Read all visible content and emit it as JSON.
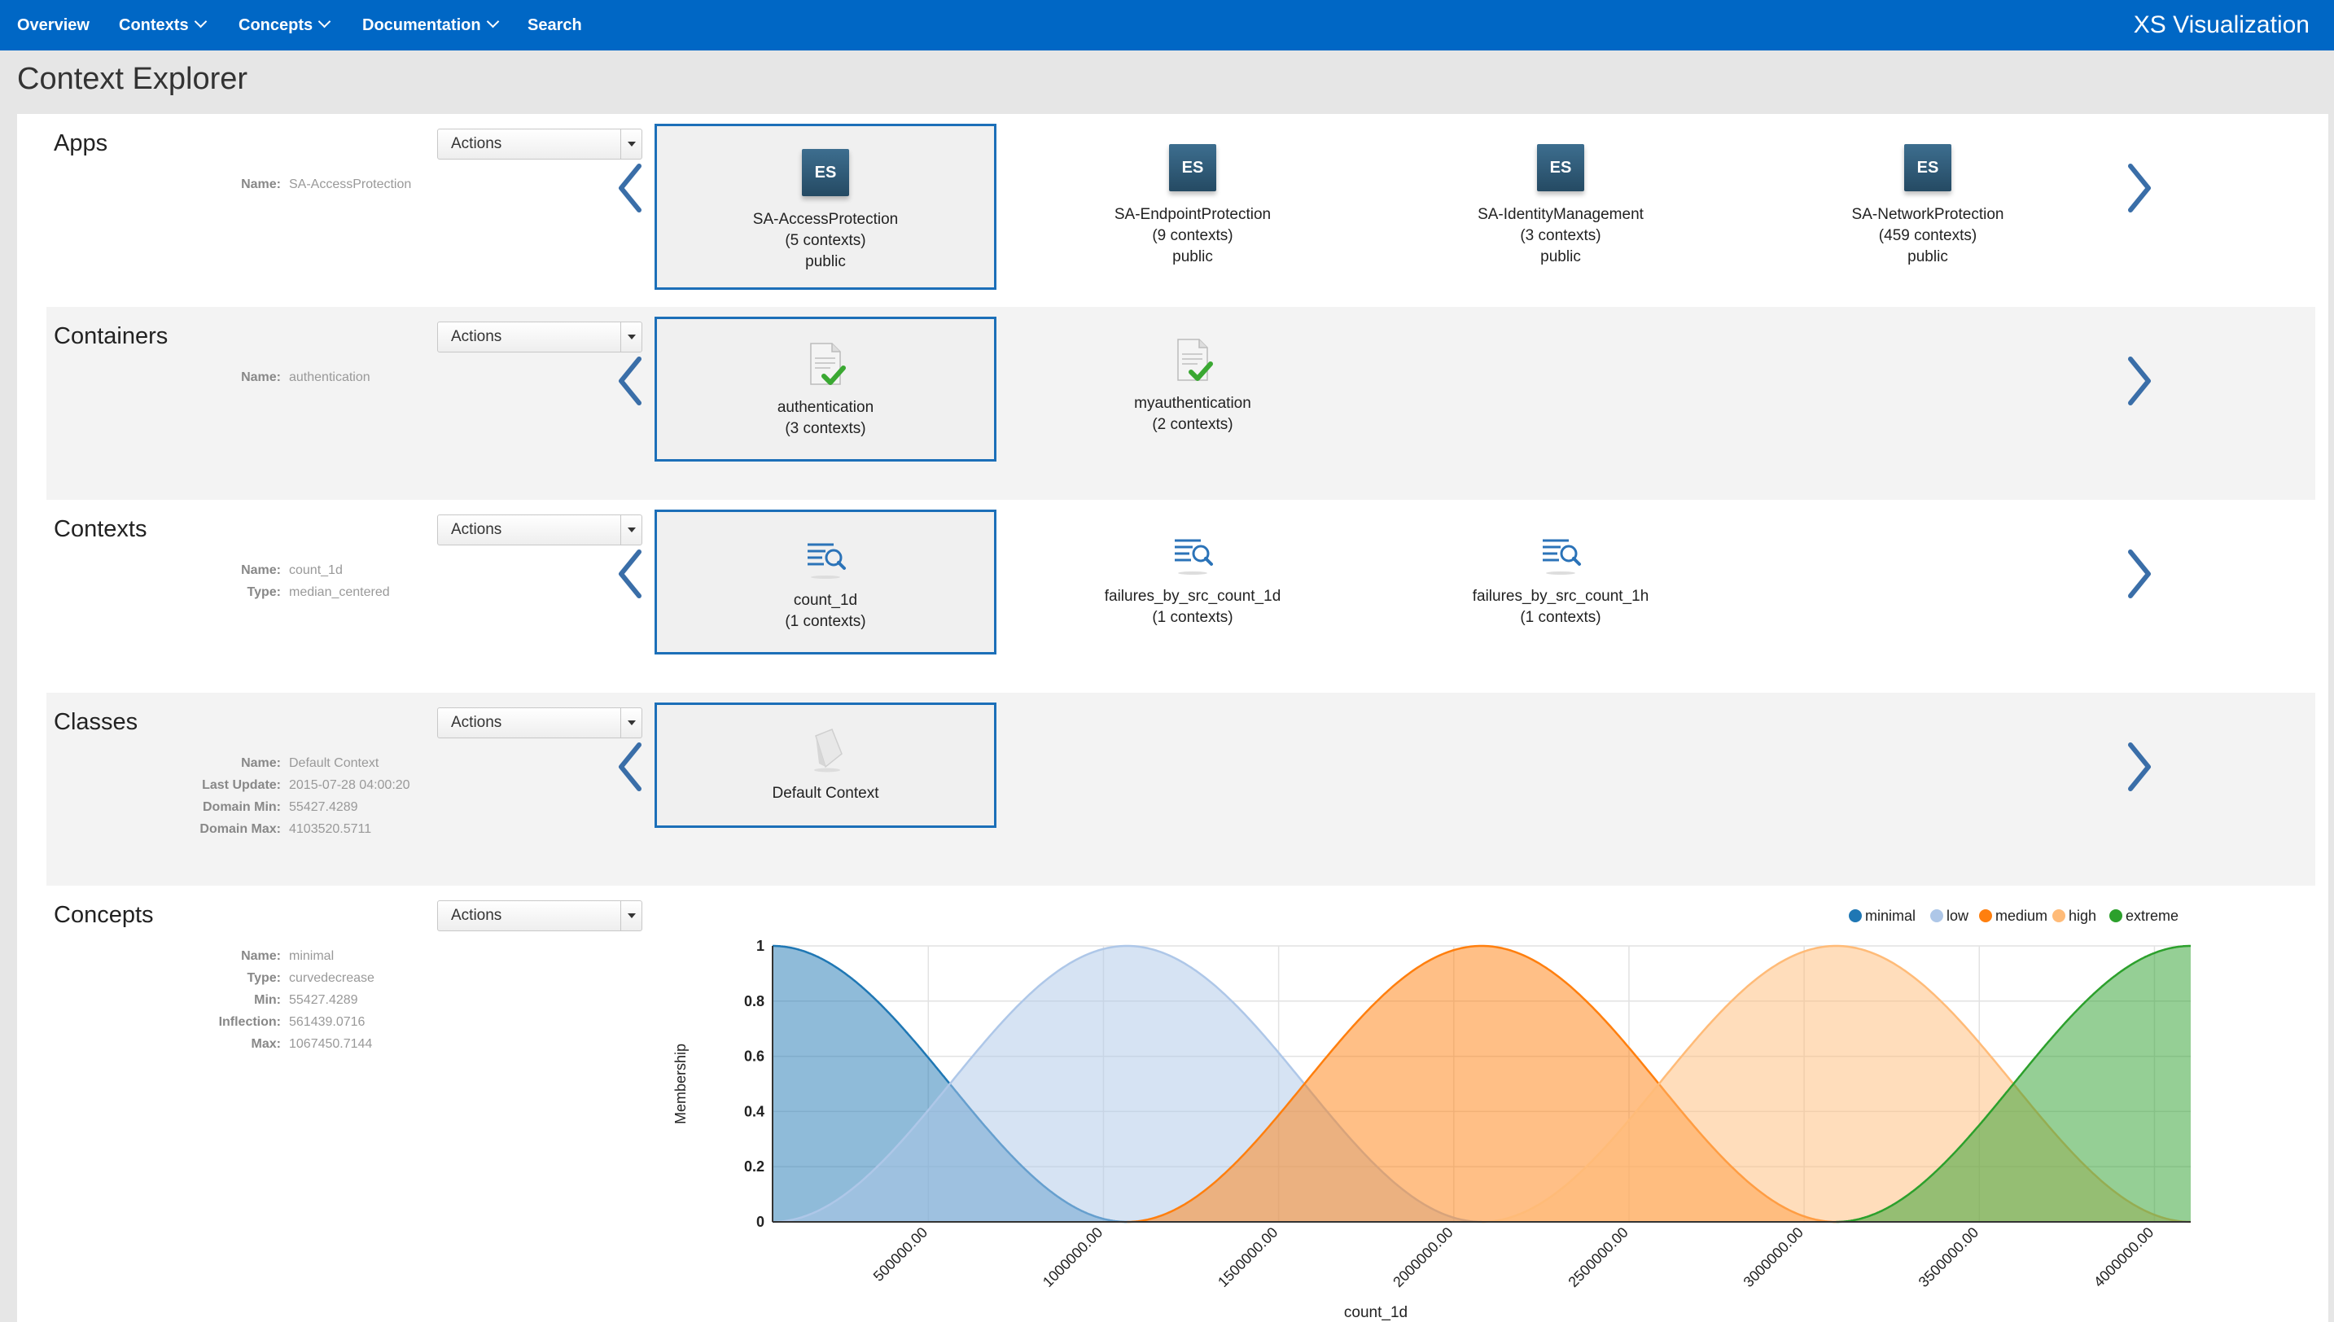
{
  "nav": {
    "items": [
      {
        "label": "Overview",
        "dropdown": false
      },
      {
        "label": "Contexts",
        "dropdown": true
      },
      {
        "label": "Concepts",
        "dropdown": true
      },
      {
        "label": "Documentation",
        "dropdown": true
      },
      {
        "label": "Search",
        "dropdown": false
      }
    ],
    "brand": "XS Visualization"
  },
  "page_title": "Context Explorer",
  "actions_label": "Actions",
  "sections": {
    "apps": {
      "title": "Apps",
      "meta": [
        {
          "key": "Name:",
          "value": "SA-AccessProtection"
        }
      ],
      "cards": [
        {
          "name": "SA-AccessProtection",
          "count": "(5 contexts)",
          "visibility": "public",
          "icon": "es-app-icon",
          "icon_text": "ES",
          "selected": true
        },
        {
          "name": "SA-EndpointProtection",
          "count": "(9 contexts)",
          "visibility": "public",
          "icon": "es-app-icon",
          "icon_text": "ES",
          "selected": false
        },
        {
          "name": "SA-IdentityManagement",
          "count": "(3 contexts)",
          "visibility": "public",
          "icon": "es-app-icon",
          "icon_text": "ES",
          "selected": false
        },
        {
          "name": "SA-NetworkProtection",
          "count": "(459 contexts)",
          "visibility": "public",
          "icon": "es-app-icon",
          "icon_text": "ES",
          "selected": false
        }
      ]
    },
    "containers": {
      "title": "Containers",
      "meta": [
        {
          "key": "Name:",
          "value": "authentication"
        }
      ],
      "cards": [
        {
          "name": "authentication",
          "count": "(3 contexts)",
          "icon": "document-check-icon",
          "selected": true
        },
        {
          "name": "myauthentication",
          "count": "(2 contexts)",
          "icon": "document-check-icon",
          "selected": false
        }
      ]
    },
    "contexts": {
      "title": "Contexts",
      "meta": [
        {
          "key": "Name:",
          "value": "count_1d"
        },
        {
          "key": "Type:",
          "value": "median_centered"
        }
      ],
      "cards": [
        {
          "name": "count_1d",
          "count": "(1 contexts)",
          "icon": "list-search-icon",
          "selected": true
        },
        {
          "name": "failures_by_src_count_1d",
          "count": "(1 contexts)",
          "icon": "list-search-icon",
          "selected": false
        },
        {
          "name": "failures_by_src_count_1h",
          "count": "(1 contexts)",
          "icon": "list-search-icon",
          "selected": false
        }
      ]
    },
    "classes": {
      "title": "Classes",
      "meta": [
        {
          "key": "Name:",
          "value": "Default Context"
        },
        {
          "key": "Last Update:",
          "value": "2015-07-28 04:00:20"
        },
        {
          "key": "Domain Min:",
          "value": "55427.4289"
        },
        {
          "key": "Domain Max:",
          "value": "4103520.5711"
        }
      ],
      "cards": [
        {
          "name": "Default Context",
          "icon": "paper-icon",
          "selected": true
        }
      ]
    },
    "concepts": {
      "title": "Concepts",
      "meta": [
        {
          "key": "Name:",
          "value": "minimal"
        },
        {
          "key": "Type:",
          "value": "curvedecrease"
        },
        {
          "key": "Min:",
          "value": "55427.4289"
        },
        {
          "key": "Inflection:",
          "value": "561439.0716"
        },
        {
          "key": "Max:",
          "value": "1067450.7144"
        }
      ]
    }
  },
  "chart_data": {
    "type": "area",
    "xlabel": "count_1d",
    "ylabel": "Membership",
    "xlim": [
      55427.4289,
      4103520.5711
    ],
    "ylim": [
      0,
      1
    ],
    "x_ticks": [
      "500000.00",
      "1000000.00",
      "1500000.00",
      "2000000.00",
      "2500000.00",
      "3000000.00",
      "3500000.00",
      "4000000.00"
    ],
    "x_tick_values": [
      500000,
      1000000,
      1500000,
      2000000,
      2500000,
      3000000,
      3500000,
      4000000
    ],
    "y_ticks": [
      "0",
      "0.2",
      "0.4",
      "0.6",
      "0.8",
      "1"
    ],
    "y_tick_values": [
      0,
      0.2,
      0.4,
      0.6,
      0.8,
      1
    ],
    "grid": true,
    "legend": "top-right",
    "series": [
      {
        "name": "minimal",
        "color": "#1f77b4",
        "x": [
          55427,
          561439,
          1067451
        ],
        "y": [
          1,
          0.5,
          0
        ]
      },
      {
        "name": "low",
        "color": "#aec7e8",
        "x": [
          55427,
          1067451,
          2079474
        ],
        "y": [
          0,
          1,
          0
        ]
      },
      {
        "name": "medium",
        "color": "#ff7f0e",
        "x": [
          1067451,
          2079474,
          3091497
        ],
        "y": [
          0,
          1,
          0
        ]
      },
      {
        "name": "high",
        "color": "#ffbb78",
        "x": [
          2079474,
          3091497,
          4103521
        ],
        "y": [
          0,
          1,
          0
        ]
      },
      {
        "name": "extreme",
        "color": "#2ca02c",
        "x": [
          3091497,
          3597508,
          4103521
        ],
        "y": [
          0,
          0.5,
          1
        ]
      }
    ]
  }
}
